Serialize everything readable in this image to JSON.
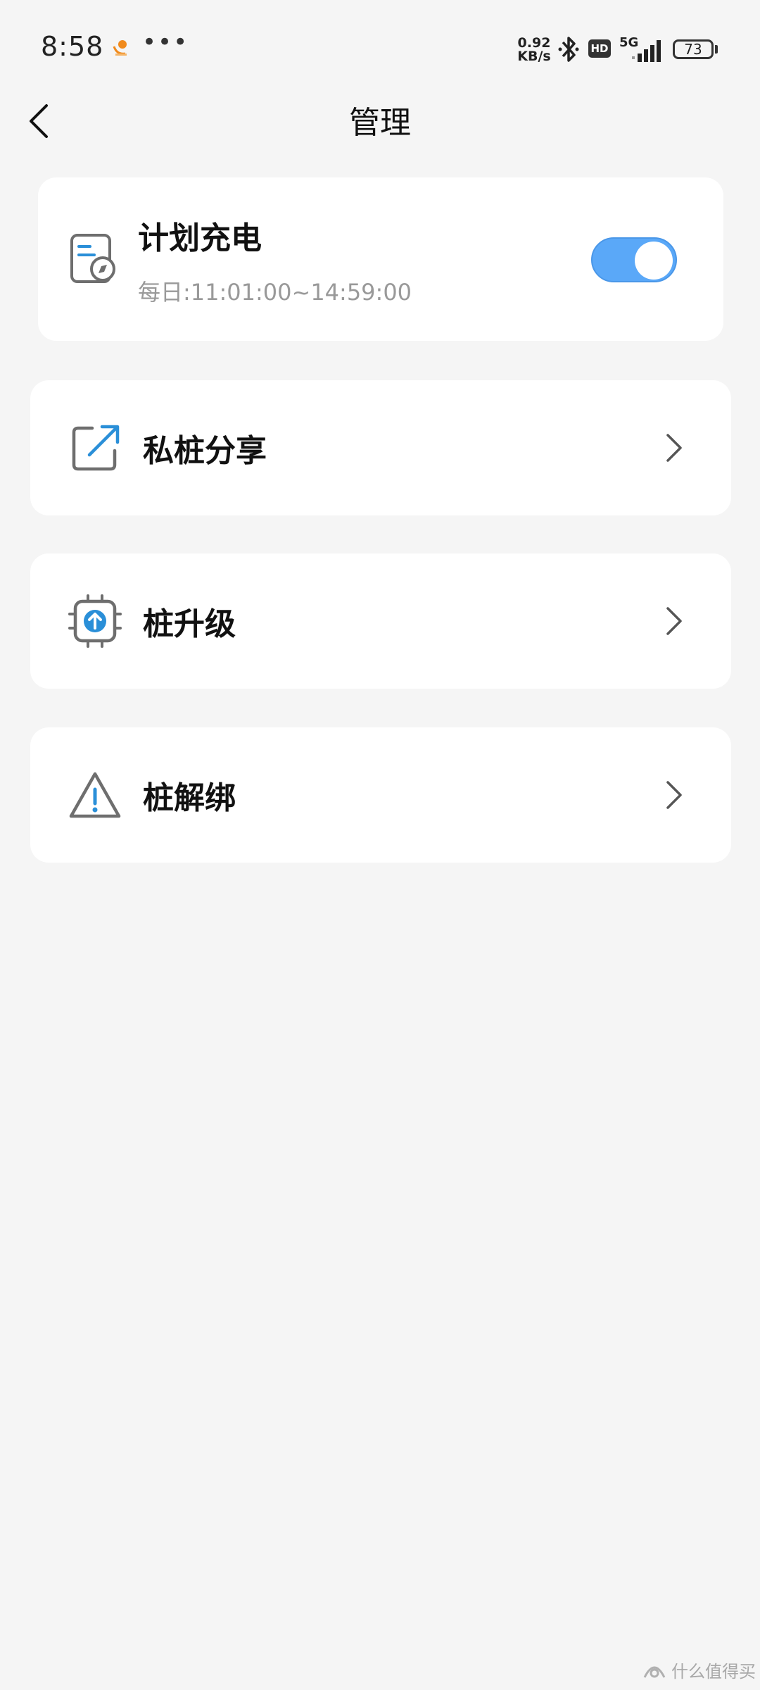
{
  "status_bar": {
    "time": "8:58",
    "more": "•••",
    "net_speed_value": "0.92",
    "net_speed_unit": "KB/s",
    "hd": "HD",
    "network": "5G",
    "battery": "73"
  },
  "header": {
    "title": "管理"
  },
  "schedule_card": {
    "title": "计划充电",
    "time_range": "每日:11:01:00~14:59:00",
    "enabled": true,
    "accent_color": "#5aa8f8"
  },
  "menu": {
    "items": [
      {
        "label": "私桩分享",
        "icon": "share-external-icon"
      },
      {
        "label": "桩升级",
        "icon": "upgrade-chip-icon"
      },
      {
        "label": "桩解绑",
        "icon": "warning-triangle-icon"
      }
    ]
  },
  "watermark": {
    "text": "什么值得买"
  },
  "colors": {
    "background": "#f5f5f5",
    "card": "#ffffff",
    "icon_gray": "#6e6e6e",
    "icon_blue": "#2a8fd8",
    "secondary_text": "#999999"
  }
}
